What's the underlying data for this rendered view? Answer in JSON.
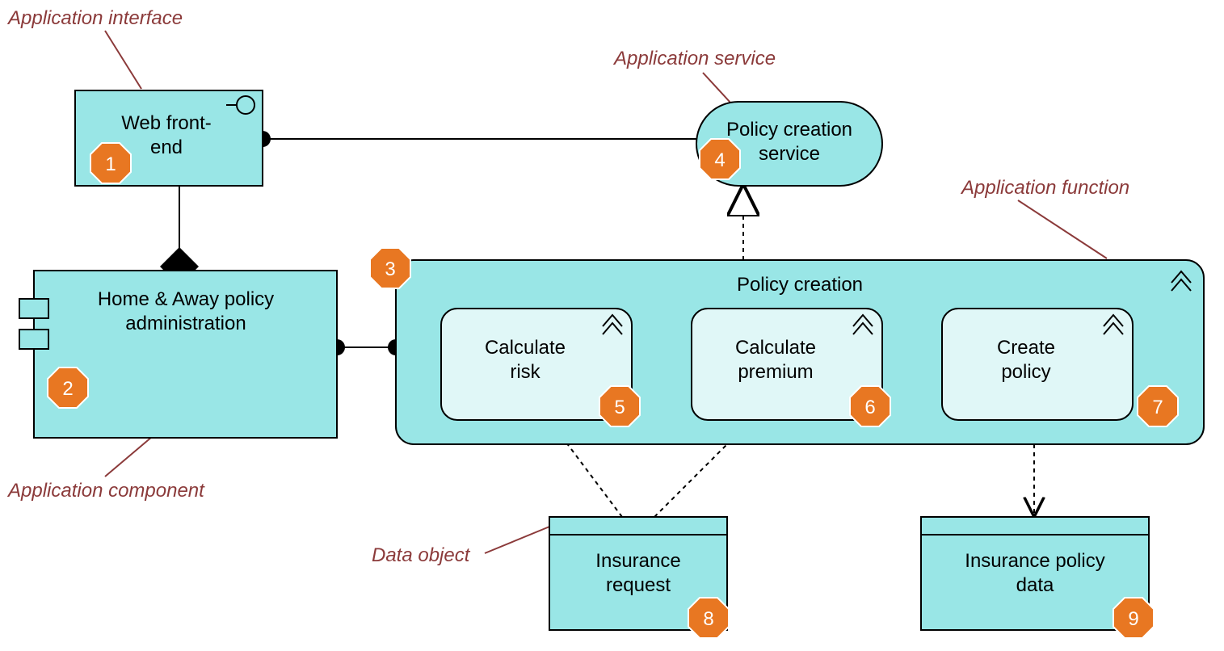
{
  "callouts": {
    "applicationInterface": "Application interface",
    "applicationService": "Application service",
    "applicationFunction": "Application function",
    "applicationComponent": "Application component",
    "dataObject": "Data object"
  },
  "nodes": {
    "webFrontEnd": {
      "line1": "Web front-",
      "line2": "end"
    },
    "policyCreationService": {
      "line1": "Policy creation",
      "line2": "service"
    },
    "homeAwayPolicy": {
      "line1": "Home & Away policy",
      "line2": "administration"
    },
    "policyCreation": "Policy creation",
    "calculateRisk": {
      "line1": "Calculate",
      "line2": "risk"
    },
    "calculatePremium": {
      "line1": "Calculate",
      "line2": "premium"
    },
    "createPolicy": {
      "line1": "Create",
      "line2": "policy"
    },
    "insuranceRequest": {
      "line1": "Insurance",
      "line2": "request"
    },
    "insurancePolicyData": {
      "line1": "Insurance policy",
      "line2": "data"
    }
  },
  "badges": {
    "b1": "1",
    "b2": "2",
    "b3": "3",
    "b4": "4",
    "b5": "5",
    "b6": "6",
    "b7": "7",
    "b8": "8",
    "b9": "9"
  }
}
